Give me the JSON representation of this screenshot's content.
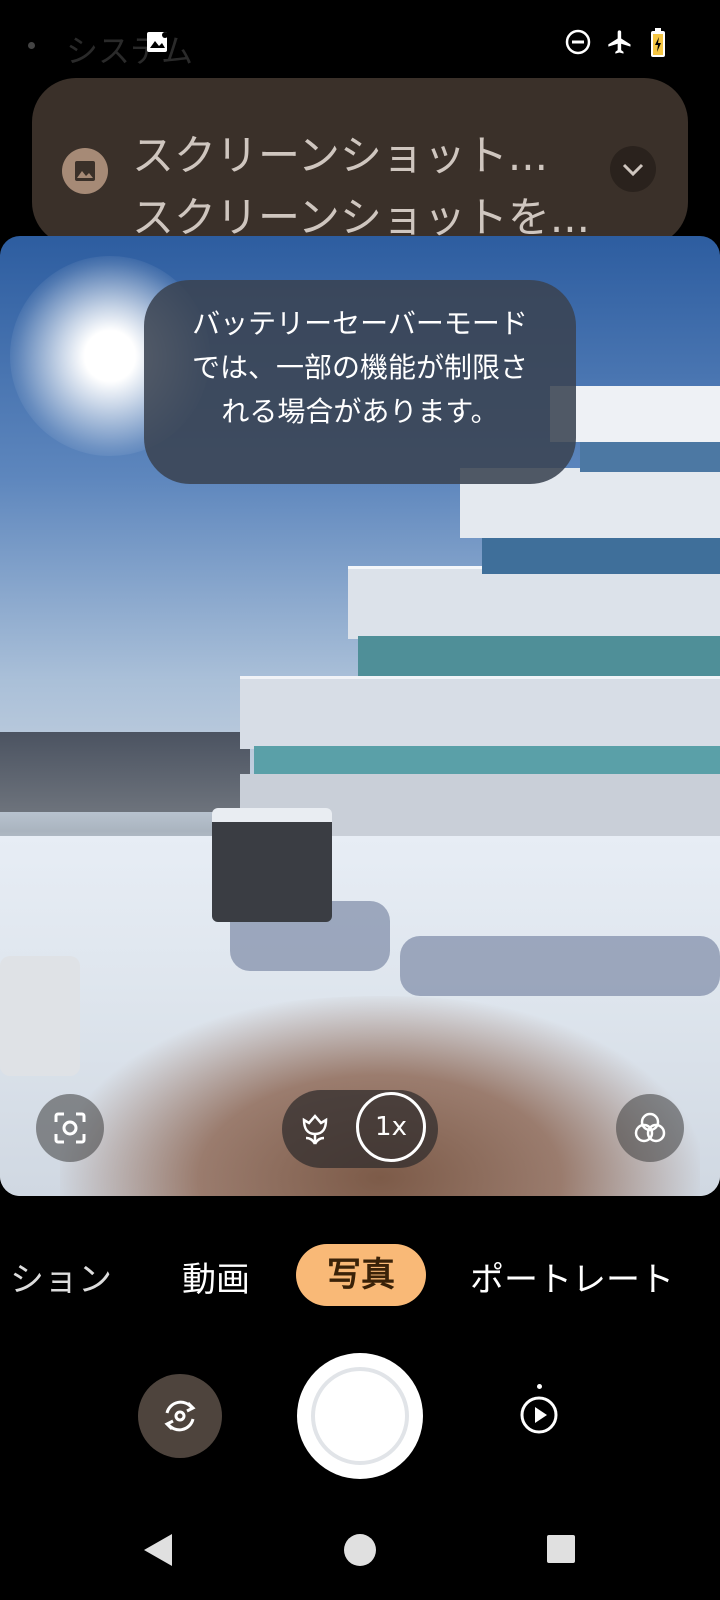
{
  "status_bar": {
    "notification_label": "システム"
  },
  "notification": {
    "title": "スクリーンショット...",
    "text": "スクリーンショットを..."
  },
  "toast": {
    "message": "バッテリーセーバーモードでは、一部の機能が制限される場合があります。"
  },
  "camera": {
    "zoom_label": "1x",
    "modes": [
      "ション",
      "動画",
      "写真",
      "ポートレート"
    ],
    "active_mode": "写真"
  },
  "icons": {
    "lens": "google-lens-icon",
    "macro": "macro-flower-icon",
    "filters": "filters-icon",
    "flip": "flip-camera-icon",
    "gallery": "gallery-play-icon",
    "nav_back": "back-triangle-icon",
    "nav_home": "home-circle-icon",
    "nav_recents": "recents-square-icon"
  },
  "colors": {
    "active_mode_bg": "#f9b977",
    "notification_bg": "#3a3029"
  }
}
